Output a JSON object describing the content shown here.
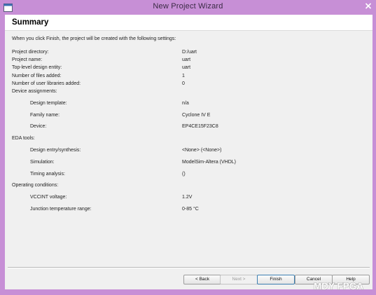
{
  "window": {
    "title": "New Project Wizard"
  },
  "page": {
    "heading": "Summary",
    "intro": "When you click Finish, the project will be created with the following settings:"
  },
  "summary": [
    {
      "label": "Project directory:",
      "value": "D:/uart",
      "indent": 0
    },
    {
      "label": "Project name:",
      "value": "uart",
      "indent": 0
    },
    {
      "label": "Top-level design entity:",
      "value": "uart",
      "indent": 0
    },
    {
      "label": "Number of files added:",
      "value": "1",
      "indent": 0
    },
    {
      "label": "Number of user libraries added:",
      "value": "0",
      "indent": 0
    },
    {
      "label": "Device assignments:",
      "value": "",
      "indent": 0
    },
    {
      "label": "Design template:",
      "value": "n/a",
      "indent": 1
    },
    {
      "label": "Family name:",
      "value": "Cyclone IV E",
      "indent": 1
    },
    {
      "label": "Device:",
      "value": "EP4CE15F23C8",
      "indent": 1
    },
    {
      "label": "EDA tools:",
      "value": "",
      "indent": 0
    },
    {
      "label": "Design entry/synthesis:",
      "value": "<None> (<None>)",
      "indent": 1
    },
    {
      "label": "Simulation:",
      "value": "ModelSim-Altera (VHDL)",
      "indent": 1
    },
    {
      "label": "Timing analysis:",
      "value": "()",
      "indent": 1
    },
    {
      "label": "Operating conditions:",
      "value": "",
      "indent": 0
    },
    {
      "label": "VCCINT voltage:",
      "value": "1.2V",
      "indent": 1
    },
    {
      "label": "Junction temperature range:",
      "value": "0-85 °C",
      "indent": 1
    }
  ],
  "buttons": {
    "back": "< Back",
    "next": "Next >",
    "finish": "Finish",
    "cancel": "Cancel",
    "help": "Help"
  },
  "watermark": "MDY FPGA",
  "icons": {
    "app": "app-window-icon",
    "close": "close-icon"
  },
  "colors": {
    "titlebar": "#c78fd6",
    "close_button": "#c7302a",
    "client_bg": "#f0f0f0"
  }
}
